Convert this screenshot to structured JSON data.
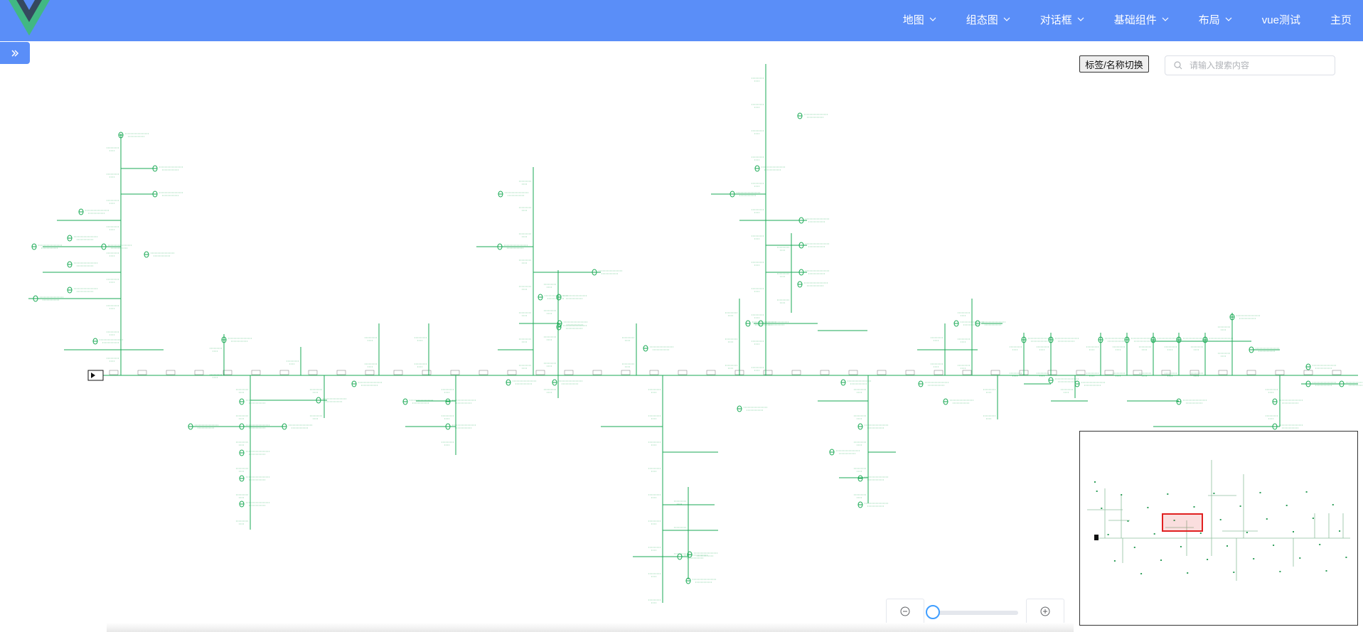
{
  "nav": {
    "items": [
      {
        "label": "地图",
        "dropdown": true
      },
      {
        "label": "组态图",
        "dropdown": true
      },
      {
        "label": "对话框",
        "dropdown": true
      },
      {
        "label": "基础组件",
        "dropdown": true
      },
      {
        "label": "布局",
        "dropdown": true
      },
      {
        "label": "vue测试",
        "dropdown": false
      },
      {
        "label": "主页",
        "dropdown": false
      }
    ]
  },
  "toolbar": {
    "label_switch": "标签/名称切换",
    "search_placeholder": "请输入搜索内容"
  },
  "zoom": {
    "level": 0
  },
  "colors": {
    "header": "#5a8ef8",
    "diagram_line": "#1aaa55",
    "minimap_viewport": "#e02020",
    "slider": "#409eff"
  },
  "icons": {
    "sidebar_toggle": "double-chevron-right-icon",
    "zoom_out": "zoom-out-icon",
    "zoom_in": "zoom-in-icon",
    "search": "search-icon"
  }
}
